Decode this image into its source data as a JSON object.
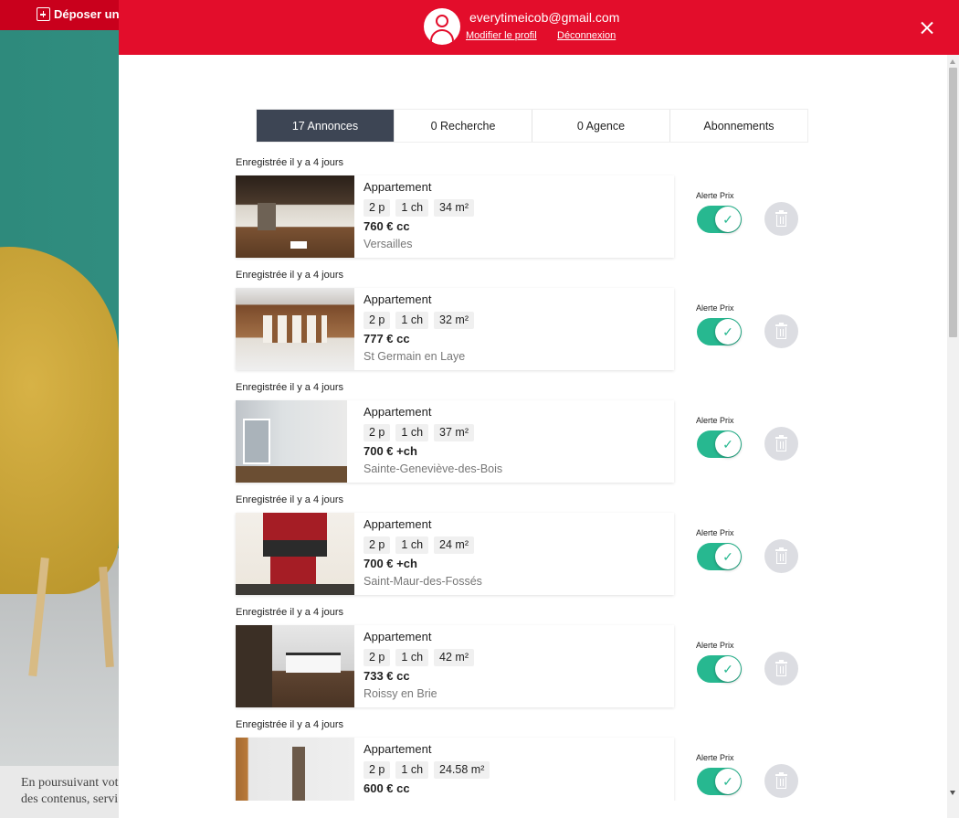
{
  "background": {
    "post_ad_label": "Déposer une",
    "cookie_text_line1": "En poursuivant vot",
    "cookie_text_line2": "des contenus, servi"
  },
  "header": {
    "email": "everytimeicob@gmail.com",
    "edit_profile": "Modifier le profil",
    "logout": "Déconnexion"
  },
  "tabs": [
    {
      "label": "17 Annonces",
      "active": true
    },
    {
      "label": "0 Recherche",
      "active": false
    },
    {
      "label": "0 Agence",
      "active": false
    },
    {
      "label": "Abonnements",
      "active": false
    }
  ],
  "listings": [
    {
      "saved": "Enregistrée il y a 4 jours",
      "type": "Appartement",
      "rooms": "2 p",
      "bedrooms": "1 ch",
      "area": "34 m²",
      "price": "760 € cc",
      "city": "Versailles",
      "alert_label": "Alerte Prix",
      "alert_on": true
    },
    {
      "saved": "Enregistrée il y a 4 jours",
      "type": "Appartement",
      "rooms": "2 p",
      "bedrooms": "1 ch",
      "area": "32 m²",
      "price": "777 € cc",
      "city": "St Germain en Laye",
      "alert_label": "Alerte Prix",
      "alert_on": true
    },
    {
      "saved": "Enregistrée il y a 4 jours",
      "type": "Appartement",
      "rooms": "2 p",
      "bedrooms": "1 ch",
      "area": "37 m²",
      "price": "700 € +ch",
      "city": "Sainte-Geneviève-des-Bois",
      "alert_label": "Alerte Prix",
      "alert_on": true
    },
    {
      "saved": "Enregistrée il y a 4 jours",
      "type": "Appartement",
      "rooms": "2 p",
      "bedrooms": "1 ch",
      "area": "24 m²",
      "price": "700 € +ch",
      "city": "Saint-Maur-des-Fossés",
      "alert_label": "Alerte Prix",
      "alert_on": true
    },
    {
      "saved": "Enregistrée il y a 4 jours",
      "type": "Appartement",
      "rooms": "2 p",
      "bedrooms": "1 ch",
      "area": "42 m²",
      "price": "733 € cc",
      "city": "Roissy en Brie",
      "alert_label": "Alerte Prix",
      "alert_on": true
    },
    {
      "saved": "Enregistrée il y a 4 jours",
      "type": "Appartement",
      "rooms": "2 p",
      "bedrooms": "1 ch",
      "area": "24.58 m²",
      "price": "600 € cc",
      "city": "",
      "alert_label": "Alerte Prix",
      "alert_on": true
    }
  ],
  "colors": {
    "header_red": "#e30d2b",
    "tab_active": "#3d4554",
    "toggle_on": "#27b890"
  },
  "icons": {
    "close": "close-icon",
    "avatar": "user-avatar-icon",
    "trash": "trash-icon",
    "check": "check-icon"
  }
}
